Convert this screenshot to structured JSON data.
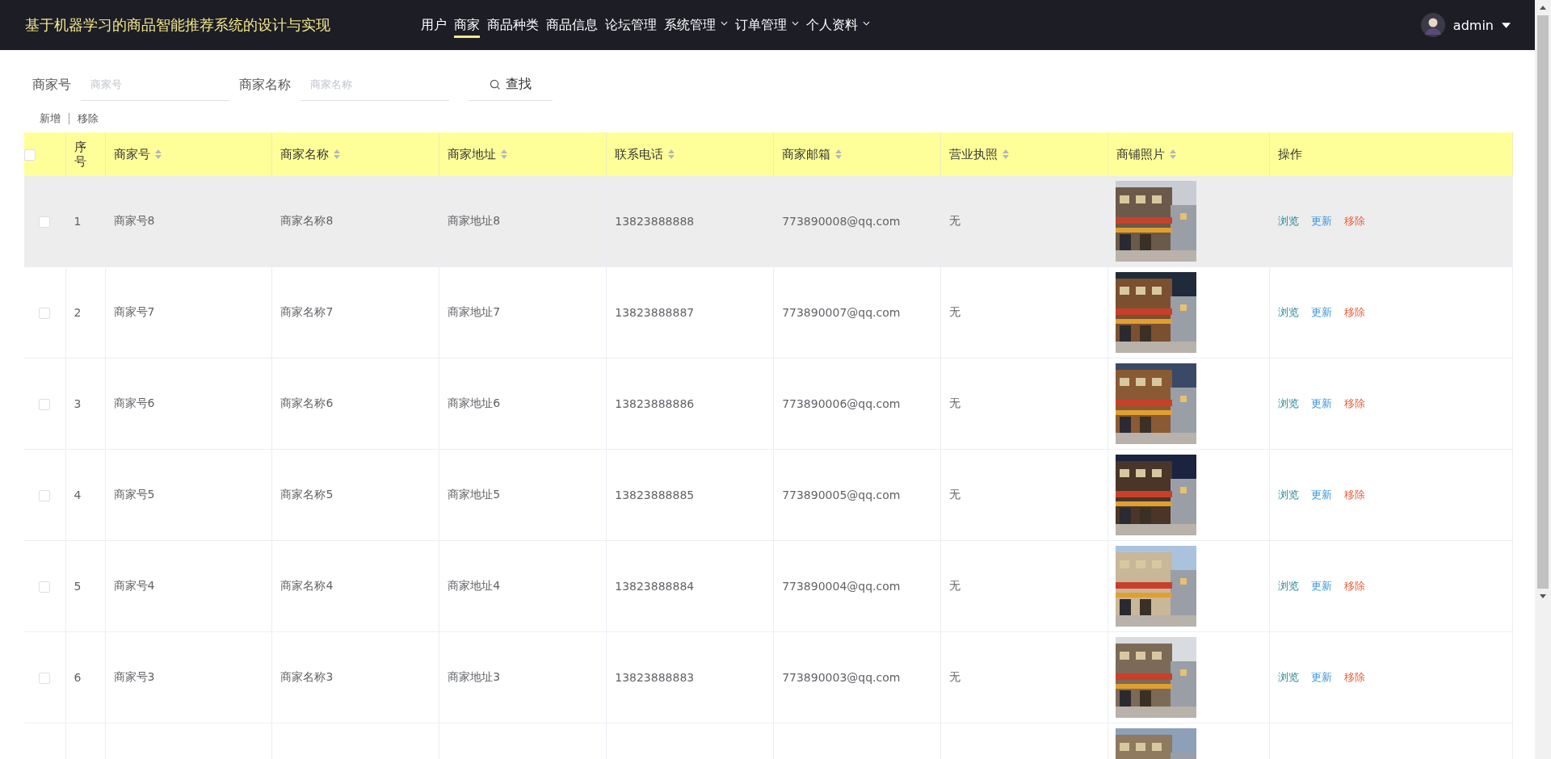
{
  "header": {
    "title": "基于机器学习的商品智能推荐系统的设计与实现",
    "nav": [
      {
        "label": "用户",
        "selected": false,
        "dropdown": false
      },
      {
        "label": "商家",
        "selected": true,
        "dropdown": false
      },
      {
        "label": "商品种类",
        "selected": false,
        "dropdown": false
      },
      {
        "label": "商品信息",
        "selected": false,
        "dropdown": false
      },
      {
        "label": "论坛管理",
        "selected": false,
        "dropdown": false
      },
      {
        "label": "系统管理",
        "selected": false,
        "dropdown": true
      },
      {
        "label": "订单管理",
        "selected": false,
        "dropdown": true
      },
      {
        "label": "个人资料",
        "selected": false,
        "dropdown": true
      }
    ],
    "user": {
      "name": "admin"
    }
  },
  "search": {
    "fields": [
      {
        "label": "商家号",
        "placeholder": "商家号"
      },
      {
        "label": "商家名称",
        "placeholder": "商家名称"
      }
    ],
    "button": "查找"
  },
  "toolbar": [
    "新增",
    "移除"
  ],
  "table": {
    "select_all": {
      "checked": false
    },
    "columns": [
      {
        "label": "序号",
        "sortable": false
      },
      {
        "label": "商家号",
        "sortable": true
      },
      {
        "label": "商家名称",
        "sortable": true
      },
      {
        "label": "商家地址",
        "sortable": true
      },
      {
        "label": "联系电话",
        "sortable": true
      },
      {
        "label": "商家邮箱",
        "sortable": true
      },
      {
        "label": "营业执照",
        "sortable": true
      },
      {
        "label": "商铺照片",
        "sortable": true
      },
      {
        "label": "操作",
        "sortable": false
      }
    ],
    "rows": [
      {
        "highlighted": true,
        "checked": false,
        "cells": [
          "1",
          "商家号8",
          "商家名称8",
          "商家地址8",
          "13823888888",
          "773890008@qq.com",
          "无"
        ],
        "photo": {
          "kind": "picture"
        },
        "actions": [
          {
            "label": "浏览",
            "kind": "view"
          },
          {
            "label": "更新",
            "kind": "update"
          },
          {
            "label": "移除",
            "kind": "remove"
          }
        ]
      },
      {
        "highlighted": false,
        "checked": false,
        "cells": [
          "2",
          "商家号7",
          "商家名称7",
          "商家地址7",
          "13823888887",
          "773890007@qq.com",
          "无"
        ],
        "photo": {
          "kind": "picture"
        },
        "actions": [
          {
            "label": "浏览",
            "kind": "view"
          },
          {
            "label": "更新",
            "kind": "update"
          },
          {
            "label": "移除",
            "kind": "remove"
          }
        ]
      },
      {
        "highlighted": false,
        "checked": false,
        "cells": [
          "3",
          "商家号6",
          "商家名称6",
          "商家地址6",
          "13823888886",
          "773890006@qq.com",
          "无"
        ],
        "photo": {
          "kind": "picture"
        },
        "actions": [
          {
            "label": "浏览",
            "kind": "view"
          },
          {
            "label": "更新",
            "kind": "update"
          },
          {
            "label": "移除",
            "kind": "remove"
          }
        ]
      },
      {
        "highlighted": false,
        "checked": false,
        "cells": [
          "4",
          "商家号5",
          "商家名称5",
          "商家地址5",
          "13823888885",
          "773890005@qq.com",
          "无"
        ],
        "photo": {
          "kind": "picture"
        },
        "actions": [
          {
            "label": "浏览",
            "kind": "view"
          },
          {
            "label": "更新",
            "kind": "update"
          },
          {
            "label": "移除",
            "kind": "remove"
          }
        ]
      },
      {
        "highlighted": false,
        "checked": false,
        "cells": [
          "5",
          "商家号4",
          "商家名称4",
          "商家地址4",
          "13823888884",
          "773890004@qq.com",
          "无"
        ],
        "photo": {
          "kind": "picture"
        },
        "actions": [
          {
            "label": "浏览",
            "kind": "view"
          },
          {
            "label": "更新",
            "kind": "update"
          },
          {
            "label": "移除",
            "kind": "remove"
          }
        ]
      },
      {
        "highlighted": false,
        "checked": false,
        "cells": [
          "6",
          "商家号3",
          "商家名称3",
          "商家地址3",
          "13823888883",
          "773890003@qq.com",
          "无"
        ],
        "photo": {
          "kind": "picture"
        },
        "actions": [
          {
            "label": "浏览",
            "kind": "view"
          },
          {
            "label": "更新",
            "kind": "update"
          },
          {
            "label": "移除",
            "kind": "remove"
          }
        ]
      },
      {
        "photo": {
          "kind": "picture"
        }
      }
    ]
  }
}
